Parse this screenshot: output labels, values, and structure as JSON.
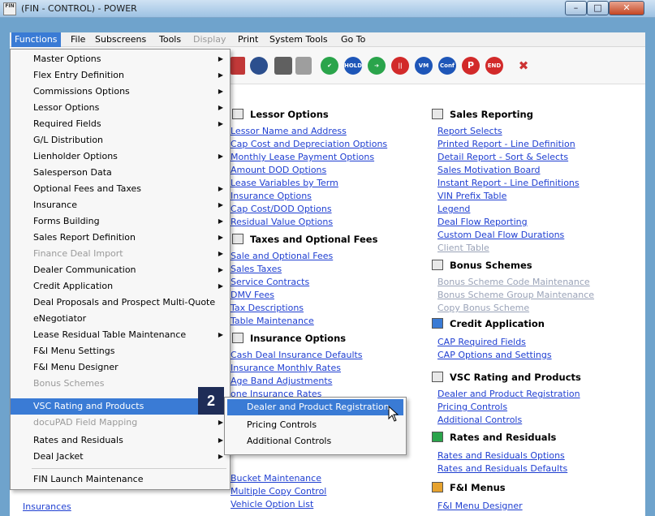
{
  "window": {
    "title": "(FIN - CONTROL) - POWER",
    "app_icon_text": "FIN",
    "controls": {
      "minimize": "–",
      "maximize": "□",
      "close": "✕"
    }
  },
  "menubar": [
    {
      "label": "Functions",
      "state": "active"
    },
    {
      "label": "File",
      "state": "normal"
    },
    {
      "label": "Subscreens",
      "state": "normal"
    },
    {
      "label": "Tools",
      "state": "normal"
    },
    {
      "label": "Display",
      "state": "disabled"
    },
    {
      "label": "Print",
      "state": "normal"
    },
    {
      "label": "System Tools",
      "state": "normal"
    },
    {
      "label": "Go To",
      "state": "normal"
    }
  ],
  "toolbar_icons": [
    {
      "name": "check-icon",
      "text": "✔"
    },
    {
      "name": "hold-icon",
      "text": "HOLD"
    },
    {
      "name": "arrow-right-icon",
      "text": "➔"
    },
    {
      "name": "stop-icon",
      "text": "||"
    },
    {
      "name": "vm-icon",
      "text": "VM"
    },
    {
      "name": "conf-icon",
      "text": "Conf"
    },
    {
      "name": "p-icon",
      "text": "P"
    },
    {
      "name": "end-icon",
      "text": "END"
    }
  ],
  "functions_menu": {
    "items": [
      {
        "label": "Master Options",
        "submenu": true
      },
      {
        "label": "Flex Entry Definition",
        "submenu": true
      },
      {
        "label": "Commissions Options",
        "submenu": true
      },
      {
        "label": "Lessor Options",
        "submenu": true
      },
      {
        "label": "Required Fields",
        "submenu": true
      },
      {
        "label": "G/L Distribution",
        "submenu": false
      },
      {
        "label": "Lienholder Options",
        "submenu": true
      },
      {
        "label": "Salesperson Data",
        "submenu": false
      },
      {
        "label": "Optional Fees and Taxes",
        "submenu": true
      },
      {
        "label": "Insurance",
        "submenu": true
      },
      {
        "label": "Forms Building",
        "submenu": true
      },
      {
        "label": "Sales Report Definition",
        "submenu": true
      },
      {
        "label": "Finance Deal Import",
        "submenu": true,
        "disabled": true
      },
      {
        "label": "Dealer Communication",
        "submenu": true
      },
      {
        "label": "Credit Application",
        "submenu": true
      },
      {
        "label": "Deal Proposals and Prospect Multi-Quote",
        "submenu": false
      },
      {
        "label": "eNegotiator",
        "submenu": false
      },
      {
        "label": "Lease Residual Table Maintenance",
        "submenu": true
      },
      {
        "label": "F&I Menu Settings",
        "submenu": false
      },
      {
        "label": "F&I Menu Designer",
        "submenu": false
      },
      {
        "label": "Bonus Schemes",
        "submenu": false,
        "disabled": true
      },
      {
        "label": "VSC Rating and Products",
        "submenu": true,
        "highlighted": true
      },
      {
        "label": "docuPAD Field Mapping",
        "submenu": true,
        "disabled": true
      },
      {
        "label": "Rates and Residuals",
        "submenu": true
      },
      {
        "label": "Deal Jacket",
        "submenu": true
      },
      {
        "label": "FIN Launch Maintenance",
        "submenu": false,
        "separator_before": true
      }
    ]
  },
  "vsc_submenu": {
    "items": [
      {
        "label": "Dealer and Product Registration",
        "highlighted": true
      },
      {
        "label": "Pricing Controls"
      },
      {
        "label": "Additional Controls"
      }
    ]
  },
  "step_badge": "2",
  "content": {
    "left_column": {
      "lessor_options": {
        "title": "Lessor Options",
        "links": [
          "Lessor Name and Address",
          "Cap Cost and Depreciation Options",
          "Monthly Lease Payment Options",
          "Amount DOD Options",
          "Lease Variables by Term",
          "Insurance Options",
          "Cap Cost/DOD Options",
          "Residual Value Options"
        ]
      },
      "taxes": {
        "title": "Taxes and Optional Fees",
        "links": [
          "Sale and Optional Fees",
          "Sales Taxes",
          "Service Contracts",
          "DMV Fees",
          "Tax Descriptions",
          "Table Maintenance"
        ]
      },
      "insurance": {
        "title": "Insurance Options",
        "links": [
          "Cash Deal Insurance Defaults",
          "Insurance Monthly Rates",
          "Age Band Adjustments",
          "one Insurance Rates"
        ],
        "links_below_menu": [
          "Bucket Maintenance",
          "Multiple Copy Control",
          "Vehicle Option List"
        ]
      },
      "partial_links": [
        "Insurances"
      ]
    },
    "right_column": {
      "sales_reporting": {
        "title": "Sales Reporting",
        "links": [
          {
            "label": "Report Selects"
          },
          {
            "label": "Printed Report - Line Definition"
          },
          {
            "label": "Detail Report - Sort & Selects"
          },
          {
            "label": "Sales Motivation Board"
          },
          {
            "label": "Instant Report - Line Definitions"
          },
          {
            "label": "VIN Prefix Table"
          },
          {
            "label": "Legend"
          },
          {
            "label": "Deal Flow Reporting"
          },
          {
            "label": "Custom Deal Flow Durations"
          },
          {
            "label": "Client Table",
            "disabled": true
          }
        ]
      },
      "bonus_schemes": {
        "title": "Bonus Schemes",
        "links": [
          {
            "label": "Bonus Scheme Code Maintenance",
            "disabled": true
          },
          {
            "label": "Bonus Scheme Group Maintenance",
            "disabled": true
          },
          {
            "label": "Copy Bonus Scheme",
            "disabled": true
          }
        ]
      },
      "credit_application": {
        "title": "Credit Application",
        "links": [
          {
            "label": "CAP Required Fields"
          },
          {
            "label": "CAP Options and Settings"
          }
        ]
      },
      "vsc": {
        "title": "VSC Rating and Products",
        "links": [
          {
            "label": "Dealer and Product Registration"
          },
          {
            "label": "Pricing Controls"
          },
          {
            "label": "Additional Controls"
          }
        ]
      },
      "rates": {
        "title": "Rates and Residuals",
        "links": [
          {
            "label": "Rates and Residuals Options"
          },
          {
            "label": "Rates and Residuals Defaults"
          }
        ]
      },
      "fi_menus": {
        "title": "F&I Menus",
        "links": [
          {
            "label": "F&I Menu Designer"
          }
        ]
      }
    }
  },
  "colors": {
    "accent": "#3a7bd5",
    "link": "#1f3fd1",
    "disabled_link": "#9aa3b8",
    "badge": "#1f2d57",
    "frame": "#6fa3cc"
  }
}
